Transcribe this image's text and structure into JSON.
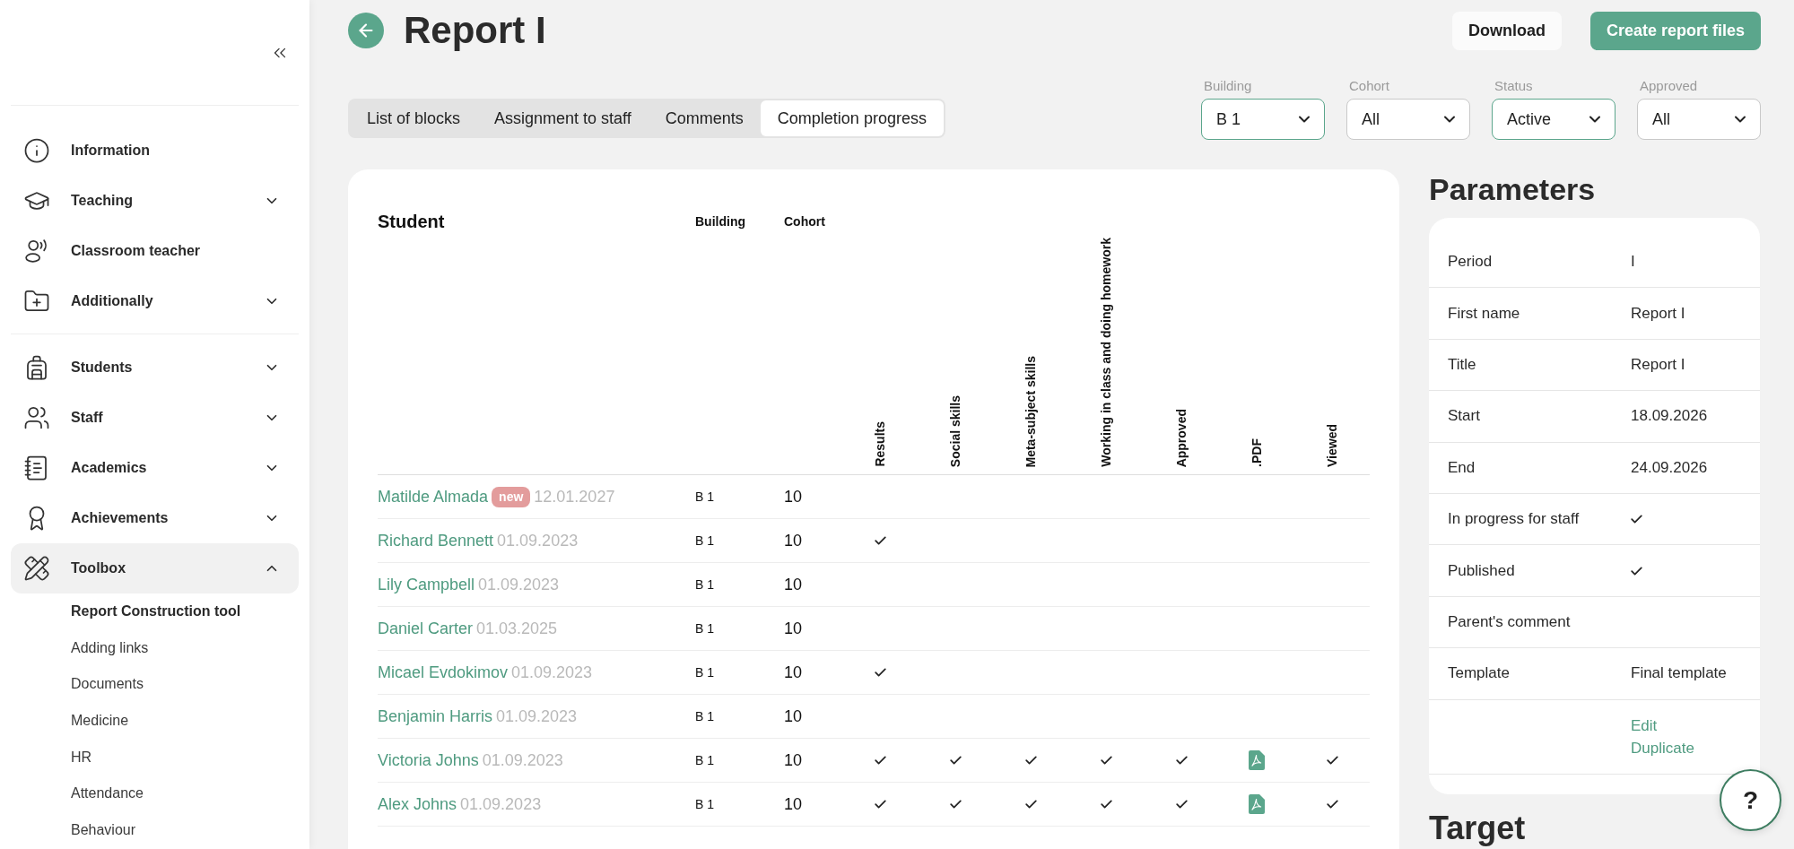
{
  "sidebar": {
    "sections": [
      {
        "items": [
          {
            "label": "Information",
            "kind": "link",
            "selected": false
          },
          {
            "label": "Teaching",
            "kind": "group",
            "selected": false,
            "expanded": false
          },
          {
            "label": "Classroom teacher",
            "kind": "link",
            "selected": false
          },
          {
            "label": "Additionally",
            "kind": "group",
            "selected": false,
            "expanded": false
          }
        ]
      },
      {
        "items": [
          {
            "label": "Students",
            "kind": "group",
            "selected": false,
            "expanded": false
          },
          {
            "label": "Staff",
            "kind": "group",
            "selected": false,
            "expanded": false
          },
          {
            "label": "Academics",
            "kind": "group",
            "selected": false,
            "expanded": false
          },
          {
            "label": "Achievements",
            "kind": "group",
            "selected": false,
            "expanded": false
          },
          {
            "label": "Toolbox",
            "kind": "group",
            "selected": true,
            "expanded": true,
            "children": [
              {
                "label": "Report Construction tool",
                "selected": true
              },
              {
                "label": "Adding links",
                "selected": false
              },
              {
                "label": "Documents",
                "selected": false
              },
              {
                "label": "Medicine",
                "selected": false
              },
              {
                "label": "HR",
                "selected": false
              },
              {
                "label": "Attendance",
                "selected": false
              },
              {
                "label": "Behaviour",
                "selected": false
              }
            ]
          }
        ]
      }
    ]
  },
  "header": {
    "title": "Report I",
    "buttons": [
      {
        "label": "Download",
        "kind": "secondary"
      },
      {
        "label": "Create report files",
        "kind": "primary"
      }
    ]
  },
  "tabs": [
    {
      "label": "List of blocks",
      "selected": false
    },
    {
      "label": "Assignment to staff",
      "selected": false
    },
    {
      "label": "Comments",
      "selected": false
    },
    {
      "label": "Completion progress",
      "selected": true
    }
  ],
  "filters": [
    {
      "label": "Building",
      "value": "B 1",
      "filtered": true
    },
    {
      "label": "Cohort",
      "value": "All",
      "filtered": false
    },
    {
      "label": "Status",
      "value": "Active",
      "filtered": true
    },
    {
      "label": "Approved",
      "value": "All",
      "filtered": false
    }
  ],
  "table": {
    "columns": [
      {
        "label": "Student",
        "kind": "student"
      },
      {
        "label": "Building",
        "kind": "text"
      },
      {
        "label": "Cohort",
        "kind": "text"
      },
      {
        "label": "Results",
        "kind": "check"
      },
      {
        "label": "Social skills",
        "kind": "check"
      },
      {
        "label": "Meta-subject skills",
        "kind": "check"
      },
      {
        "label": "Working in class and doing homework",
        "kind": "check"
      },
      {
        "label": "Approved",
        "kind": "check"
      },
      {
        "label": ".PDF",
        "kind": "file"
      },
      {
        "label": "Viewed",
        "kind": "check"
      }
    ],
    "rows": [
      {
        "name": "Matilde Almada",
        "badge": "new",
        "date": "12.01.2027",
        "building": "B 1",
        "cohort": "10",
        "marks": [
          false,
          false,
          false,
          false,
          false,
          false,
          false
        ]
      },
      {
        "name": "Richard Bennett",
        "date": "01.09.2023",
        "building": "B 1",
        "cohort": "10",
        "marks": [
          true,
          false,
          false,
          false,
          false,
          false,
          false
        ]
      },
      {
        "name": "Lily Campbell",
        "date": "01.09.2023",
        "building": "B 1",
        "cohort": "10",
        "marks": [
          false,
          false,
          false,
          false,
          false,
          false,
          false
        ]
      },
      {
        "name": "Daniel Carter",
        "date": "01.03.2025",
        "building": "B 1",
        "cohort": "10",
        "marks": [
          false,
          false,
          false,
          false,
          false,
          false,
          false
        ]
      },
      {
        "name": "Micael Evdokimov",
        "date": "01.09.2023",
        "building": "B 1",
        "cohort": "10",
        "marks": [
          true,
          false,
          false,
          false,
          false,
          false,
          false
        ]
      },
      {
        "name": "Benjamin Harris",
        "date": "01.09.2023",
        "building": "B 1",
        "cohort": "10",
        "marks": [
          false,
          false,
          false,
          false,
          false,
          false,
          false
        ]
      },
      {
        "name": "Victoria Johns",
        "date": "01.09.2023",
        "building": "B 1",
        "cohort": "10",
        "marks": [
          true,
          true,
          true,
          true,
          true,
          true,
          true
        ]
      },
      {
        "name": "Alex Johns",
        "date": "01.09.2023",
        "building": "B 1",
        "cohort": "10",
        "marks": [
          true,
          true,
          true,
          true,
          true,
          true,
          true
        ]
      }
    ]
  },
  "parameters": {
    "title": "Parameters",
    "rows": [
      {
        "label": "Period",
        "kind": "text",
        "value": "I"
      },
      {
        "label": "First name",
        "kind": "text",
        "value": "Report I"
      },
      {
        "label": "Title",
        "kind": "text",
        "value": "Report I"
      },
      {
        "label": "Start",
        "kind": "text",
        "value": "18.09.2026"
      },
      {
        "label": "End",
        "kind": "text",
        "value": "24.09.2026"
      },
      {
        "label": "In progress for staff",
        "kind": "check",
        "checked": true
      },
      {
        "label": "Published",
        "kind": "check",
        "checked": true
      },
      {
        "label": "Parent's comment",
        "kind": "text"
      },
      {
        "label": "Template",
        "kind": "text",
        "value": "Final template"
      },
      {
        "kind": "links",
        "links": [
          "Edit",
          "Duplicate"
        ]
      }
    ]
  },
  "target": {
    "title": "Target"
  },
  "help": {
    "label": "?"
  }
}
